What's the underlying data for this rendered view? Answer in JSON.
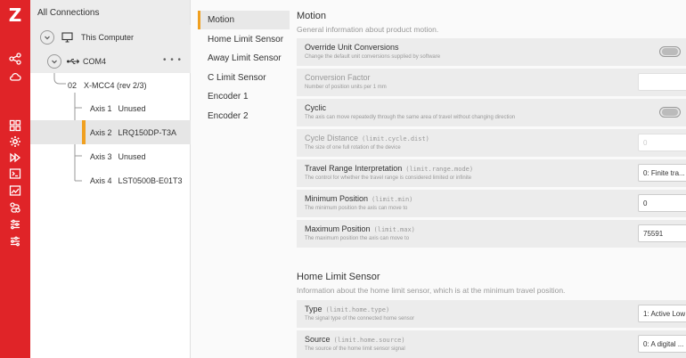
{
  "app": {
    "logo": "Z"
  },
  "rail": {
    "top_icons": [
      "share-icon",
      "cloud-icon"
    ],
    "mid_icons": [
      "grid-icon",
      "gear-icon",
      "play-forward-icon",
      "terminal-icon",
      "chart-icon",
      "steps-icon",
      "sliders-icon",
      "sliders-alt-icon"
    ],
    "active_icon": "gear-icon"
  },
  "tree": {
    "header": "All Connections",
    "computer": "This Computer",
    "port": "COM4",
    "controller_num": "02",
    "controller": "X-MCC4 (rev 2/3)",
    "axes": [
      {
        "label": "Axis 1",
        "device": "Unused"
      },
      {
        "label": "Axis 2",
        "device": "LRQ150DP-T3A"
      },
      {
        "label": "Axis 3",
        "device": "Unused"
      },
      {
        "label": "Axis 4",
        "device": "LST0500B-E01T3"
      }
    ]
  },
  "sections": [
    "Motion",
    "Home Limit Sensor",
    "Away Limit Sensor",
    "C Limit Sensor",
    "Encoder 1",
    "Encoder 2"
  ],
  "motion": {
    "title": "Motion",
    "description": "General information about product motion.",
    "props": [
      {
        "name": "Override Unit Conversions",
        "code": "",
        "desc": "Change the default unit conversions supplied by software",
        "control": "toggle",
        "value": ""
      },
      {
        "name": "Conversion Factor",
        "code": "",
        "desc": "Number of position units per 1 mm",
        "control": "field",
        "value": ""
      },
      {
        "name": "Cyclic",
        "code": "",
        "desc": "The axis can move repeatedly through the same area of travel without changing direction",
        "control": "toggle",
        "value": ""
      },
      {
        "name": "Cycle Distance",
        "code": "(limit.cycle.dist)",
        "desc": "The size of one full rotation of the device",
        "control": "field",
        "value": "0"
      },
      {
        "name": "Travel Range Interpretation",
        "code": "(limit.range.mode)",
        "desc": "The control for whether the travel range is considered limited or infinite",
        "control": "field",
        "value": "0: Finite tra..."
      },
      {
        "name": "Minimum Position",
        "code": "(limit.min)",
        "desc": "The minimum position the axis can move to",
        "control": "field",
        "value": "0"
      },
      {
        "name": "Maximum Position",
        "code": "(limit.max)",
        "desc": "The maximum position the axis can move to",
        "control": "field",
        "value": "75591"
      }
    ]
  },
  "home": {
    "title": "Home Limit Sensor",
    "description": "Information about the home limit sensor, which is at the minimum travel position.",
    "props": [
      {
        "name": "Type",
        "code": "(limit.home.type)",
        "desc": "The signal type of the connected home sensor",
        "control": "field",
        "value": "1: Active Low"
      },
      {
        "name": "Source",
        "code": "(limit.home.source)",
        "desc": "The source of the home limit sensor signal",
        "control": "field",
        "value": "0: A digital ..."
      }
    ]
  },
  "colors": {
    "brand": "#e02428",
    "accent": "#f0a020"
  }
}
